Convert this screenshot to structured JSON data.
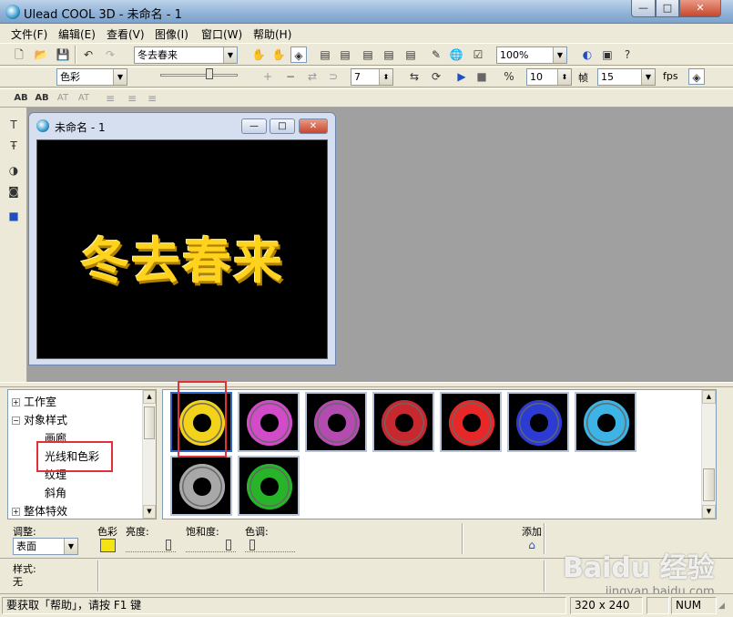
{
  "window": {
    "title": "Ulead COOL 3D - 未命名 - 1",
    "min": "—",
    "max": "□",
    "close": "✕"
  },
  "menu": [
    "文件(F)",
    "编辑(E)",
    "查看(V)",
    "图像(I)",
    "窗口(W)",
    "帮助(H)"
  ],
  "toolbar1": {
    "text_combo": "冬去春来",
    "zoom_combo": "100%"
  },
  "toolbar2": {
    "attr_combo": "色彩",
    "frame_value": "7",
    "fps_value": "10",
    "frame_label": "帧",
    "frames_value": "15",
    "fps_label": "fps"
  },
  "toolbar3": {
    "text_tools": [
      "AB",
      "AB",
      "AT",
      "AT"
    ]
  },
  "child_window": {
    "title": "未命名 - 1",
    "canvas_text": "冬去春来"
  },
  "tree": {
    "items": [
      {
        "label": "工作室",
        "sign": "+"
      },
      {
        "label": "对象样式",
        "sign": "−"
      },
      {
        "label": "画廊",
        "sign": ""
      },
      {
        "label": "光线和色彩",
        "sign": ""
      },
      {
        "label": "纹理",
        "sign": ""
      },
      {
        "label": "斜角",
        "sign": ""
      },
      {
        "label": "整体特效",
        "sign": "+"
      }
    ]
  },
  "gallery": {
    "colors": [
      "#f2d21a",
      "#d24bc8",
      "#b44bb0",
      "#c8282e",
      "#e82828",
      "#2c3cd2",
      "#3cb4e6",
      "#a8a8a8",
      "#28b428"
    ]
  },
  "adjust": {
    "adjust_label": "调整:",
    "surface_combo": "表面",
    "color_label": "色彩",
    "brightness_label": "亮度:",
    "saturation_label": "饱和度:",
    "hue_label": "色调:",
    "add_label": "添加",
    "swatch_color": "#f4e414"
  },
  "style_info": {
    "label": "样式:",
    "value": "无"
  },
  "status": {
    "help": "要获取「帮助」，请按 F1 键",
    "size": "320 x 240",
    "num": "NUM"
  },
  "watermark": {
    "main": "Baidu 经验",
    "sub": "jingyan.baidu.com"
  }
}
